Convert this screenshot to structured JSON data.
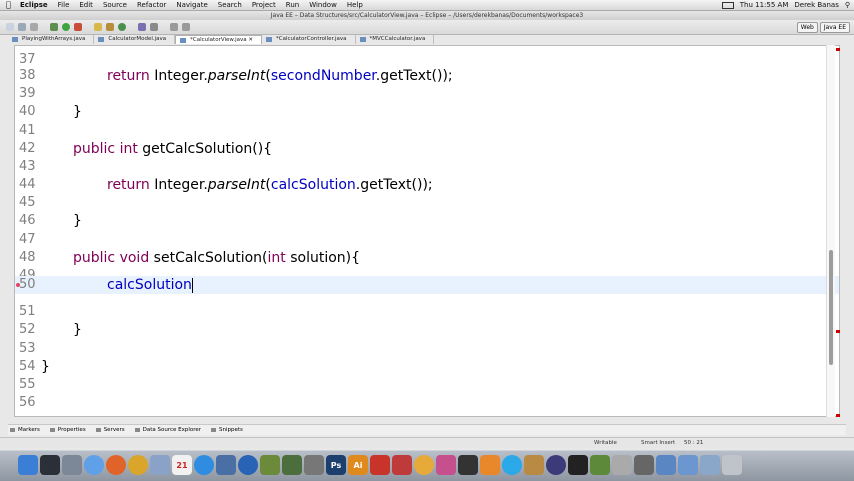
{
  "menubar": {
    "apple": "",
    "app": "Eclipse",
    "menus": [
      "File",
      "Edit",
      "Source",
      "Refactor",
      "Navigate",
      "Search",
      "Project",
      "Run",
      "Window",
      "Help"
    ],
    "clock": "Thu 11:55 AM",
    "user": "Derek Banas"
  },
  "window": {
    "title": "Java EE – Data Structures/src/CalculatorView.java – Eclipse – /Users/derekbanas/Documents/workspace3"
  },
  "perspectives": [
    "Web",
    "Java EE"
  ],
  "tabs": [
    {
      "label": "PlayingWithArrays.java",
      "active": false
    },
    {
      "label": "CalculatorModel.java",
      "active": false
    },
    {
      "label": "*CalculatorView.java",
      "active": true
    },
    {
      "label": "*CalculatorController.java",
      "active": false
    },
    {
      "label": "*MVCCalculator.java",
      "active": false
    }
  ],
  "editor": {
    "lines": [
      {
        "n": "37",
        "code": ""
      },
      {
        "n": "38",
        "code": "return Integer.parseInt(secondNumber.getText());"
      },
      {
        "n": "39",
        "code": ""
      },
      {
        "n": "40",
        "code": "}"
      },
      {
        "n": "41",
        "code": ""
      },
      {
        "n": "42",
        "code": "public int getCalcSolution(){"
      },
      {
        "n": "43",
        "code": ""
      },
      {
        "n": "44",
        "code": "return Integer.parseInt(calcSolution.getText());"
      },
      {
        "n": "45",
        "code": ""
      },
      {
        "n": "46",
        "code": "}"
      },
      {
        "n": "47",
        "code": ""
      },
      {
        "n": "48",
        "code": "public void setCalcSolution(int solution){"
      },
      {
        "n": "49",
        "code": ""
      },
      {
        "n": "50",
        "code": "calcSolution"
      },
      {
        "n": "51",
        "code": ""
      },
      {
        "n": "52",
        "code": "}"
      },
      {
        "n": "53",
        "code": ""
      },
      {
        "n": "54",
        "code": "}"
      },
      {
        "n": "55",
        "code": ""
      },
      {
        "n": "56",
        "code": ""
      }
    ]
  },
  "views": [
    "Markers",
    "Properties",
    "Servers",
    "Data Source Explorer",
    "Snippets"
  ],
  "status": {
    "mode": "Writable",
    "insert": "Smart Insert",
    "position": "50 : 21"
  },
  "dock_icons": [
    "finder",
    "dashboard",
    "system-prefs",
    "itunes",
    "firefox",
    "chrome",
    "mail",
    "calendar",
    "safari",
    "textedit",
    "photos",
    "app-store",
    "time-machine",
    "photoshop",
    "illustrator",
    "acrobat",
    "dreamweaver",
    "flash",
    "vlc",
    "skype",
    "eclipse",
    "terminal",
    "minecraft",
    "misc",
    "misc2",
    "downloads",
    "documents",
    "trash"
  ]
}
